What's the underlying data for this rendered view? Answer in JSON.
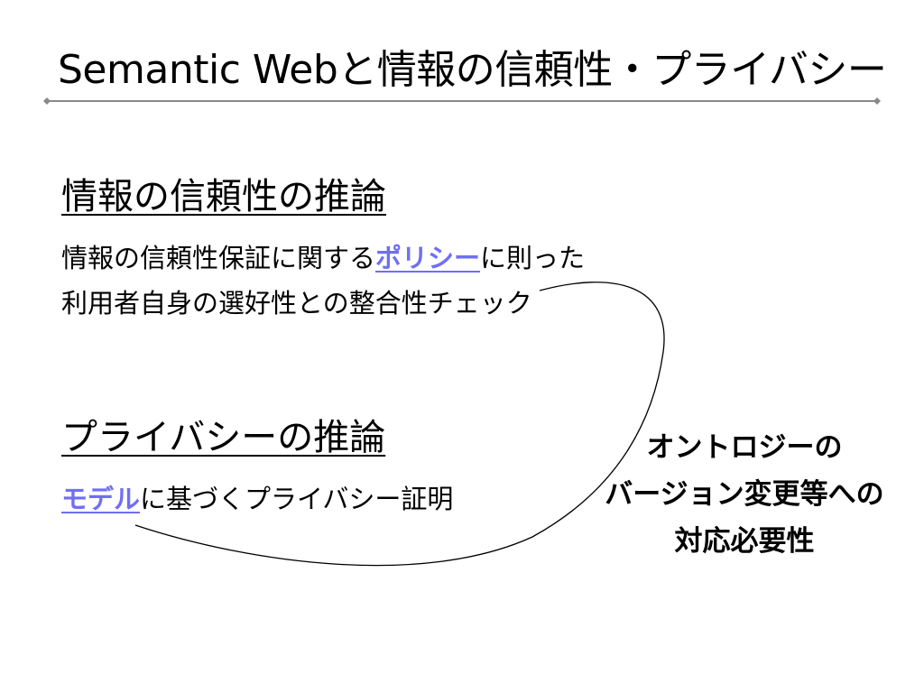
{
  "slide": {
    "title": "Semantic Webと情報の信頼性・プライバシー",
    "section1": {
      "heading": "情報の信頼性の推論",
      "line1_before": "情報の信頼性保証に関する",
      "line1_link": "ポリシー",
      "line1_after": "に則った",
      "line2": "利用者自身の選好性との整合性チェック"
    },
    "section2": {
      "heading": "プライバシーの推論",
      "line_link": "モデル",
      "line_after": "に基づくプライバシー証明"
    },
    "callout": {
      "line1": "オントロジーの",
      "line2": "バージョン変更等への",
      "line3": "対応必要性"
    },
    "colors": {
      "link": "#6f6ff5",
      "divider": "#8a8a8a",
      "text": "#000000"
    }
  }
}
